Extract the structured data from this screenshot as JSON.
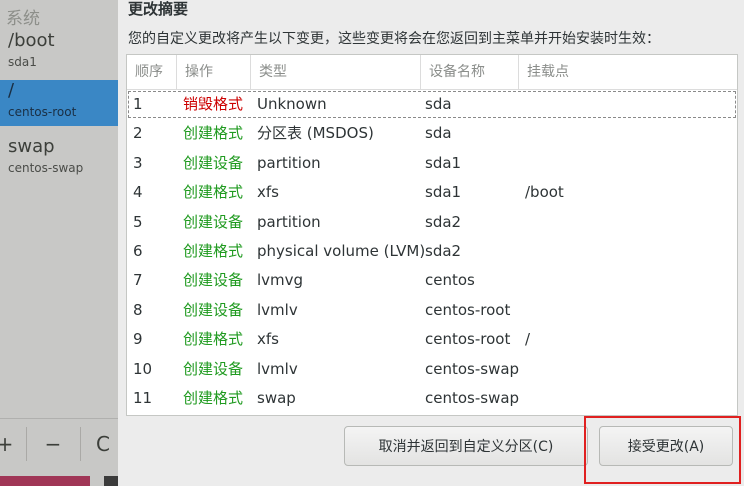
{
  "left_panel": {
    "header": "系统",
    "items": [
      {
        "mount": "/boot",
        "device": "sda1",
        "selected": false
      },
      {
        "mount": "/",
        "device": "centos-root",
        "selected": true
      },
      {
        "mount": "swap",
        "device": "centos-swap",
        "selected": false
      }
    ],
    "toolbar": {
      "add": "+",
      "remove": "−",
      "refresh": "C"
    }
  },
  "dialog": {
    "title": "更改摘要",
    "description": "您的自定义更改将产生以下变更，这些变更将会在您返回到主菜单并开始安装时生效：",
    "columns": [
      "顺序",
      "操作",
      "类型",
      "设备名称",
      "挂载点"
    ],
    "rows": [
      {
        "order": "1",
        "action": "销毁格式",
        "action_kind": "destroy",
        "type": "Unknown",
        "device": "sda",
        "mount": ""
      },
      {
        "order": "2",
        "action": "创建格式",
        "action_kind": "create",
        "type": "分区表 (MSDOS)",
        "device": "sda",
        "mount": ""
      },
      {
        "order": "3",
        "action": "创建设备",
        "action_kind": "create",
        "type": "partition",
        "device": "sda1",
        "mount": ""
      },
      {
        "order": "4",
        "action": "创建格式",
        "action_kind": "create",
        "type": "xfs",
        "device": "sda1",
        "mount": "/boot"
      },
      {
        "order": "5",
        "action": "创建设备",
        "action_kind": "create",
        "type": "partition",
        "device": "sda2",
        "mount": ""
      },
      {
        "order": "6",
        "action": "创建格式",
        "action_kind": "create",
        "type": "physical volume (LVM)",
        "device": "sda2",
        "mount": ""
      },
      {
        "order": "7",
        "action": "创建设备",
        "action_kind": "create",
        "type": "lvmvg",
        "device": "centos",
        "mount": ""
      },
      {
        "order": "8",
        "action": "创建设备",
        "action_kind": "create",
        "type": "lvmlv",
        "device": "centos-root",
        "mount": ""
      },
      {
        "order": "9",
        "action": "创建格式",
        "action_kind": "create",
        "type": "xfs",
        "device": "centos-root",
        "mount": "/"
      },
      {
        "order": "10",
        "action": "创建设备",
        "action_kind": "create",
        "type": "lvmlv",
        "device": "centos-swap",
        "mount": ""
      },
      {
        "order": "11",
        "action": "创建格式",
        "action_kind": "create",
        "type": "swap",
        "device": "centos-swap",
        "mount": ""
      }
    ],
    "buttons": {
      "cancel": "取消并返回到自定义分区(C)",
      "accept": "接受更改(A)"
    }
  },
  "colors": {
    "destroy": "#cc0000",
    "create": "#1f9a1f",
    "selected": "#3a87c5",
    "highlight": "#e02020"
  }
}
